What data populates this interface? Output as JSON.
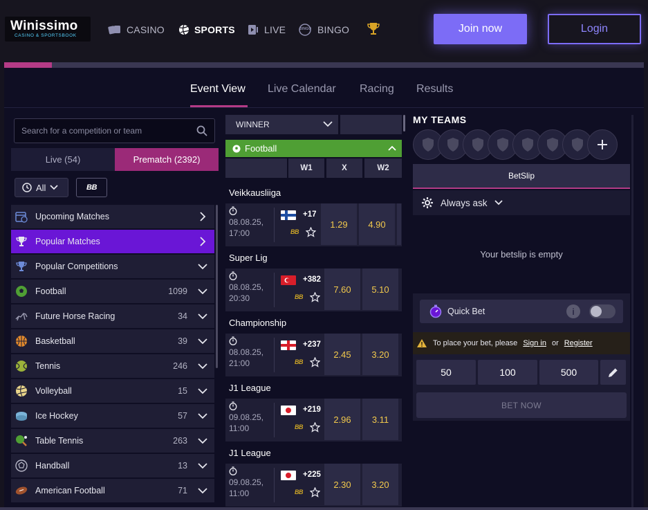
{
  "header": {
    "logo_text": "Winissimo",
    "logo_sub": "CASINO & SPORTSBOOK",
    "nav": [
      {
        "label": "CASINO"
      },
      {
        "label": "SPORTS"
      },
      {
        "label": "LIVE"
      },
      {
        "label": "BINGO"
      }
    ],
    "bingo_icon_text": "BINGO",
    "join_label": "Join now",
    "login_label": "Login"
  },
  "tabs": [
    "Event View",
    "Live Calendar",
    "Racing",
    "Results"
  ],
  "left": {
    "search_placeholder": "Search for a competition or team",
    "live_tab": "Live (54)",
    "prematch_tab": "Prematch (2392)",
    "time_filter": "All",
    "bb_label": "BB",
    "items": [
      {
        "label": "Upcoming Matches",
        "count": ""
      },
      {
        "label": "Popular Matches",
        "count": ""
      },
      {
        "label": "Popular Competitions",
        "count": ""
      },
      {
        "label": "Football",
        "count": "1099"
      },
      {
        "label": "Future Horse Racing",
        "count": "34"
      },
      {
        "label": "Basketball",
        "count": "39"
      },
      {
        "label": "Tennis",
        "count": "246"
      },
      {
        "label": "Volleyball",
        "count": "15"
      },
      {
        "label": "Ice Hockey",
        "count": "57"
      },
      {
        "label": "Table Tennis",
        "count": "263"
      },
      {
        "label": "Handball",
        "count": "13"
      },
      {
        "label": "American Football",
        "count": "71"
      }
    ]
  },
  "middle": {
    "market_select": "WINNER",
    "sport_bar": "Football",
    "odds_headers": [
      "W1",
      "X",
      "W2"
    ],
    "matches": [
      {
        "league": "Veikkausliiga",
        "date": "08.08.25,",
        "time": "17:00",
        "more": "+17",
        "bb": "BB",
        "odds": [
          "1.29",
          "4.90"
        ]
      },
      {
        "league": "Super Lig",
        "date": "08.08.25,",
        "time": "20:30",
        "more": "+382",
        "bb": "BB",
        "odds": [
          "7.60",
          "5.10"
        ]
      },
      {
        "league": "Championship",
        "date": "08.08.25,",
        "time": "21:00",
        "more": "+237",
        "bb": "BB",
        "odds": [
          "2.45",
          "3.20"
        ]
      },
      {
        "league": "J1 League",
        "date": "09.08.25,",
        "time": "11:00",
        "more": "+219",
        "bb": "BB",
        "odds": [
          "2.96",
          "3.11"
        ]
      },
      {
        "league": "J1 League",
        "date": "09.08.25,",
        "time": "11:00",
        "more": "+225",
        "bb": "BB",
        "odds": [
          "2.30",
          "3.20"
        ]
      }
    ]
  },
  "right": {
    "my_teams_title": "MY TEAMS",
    "betslip_tab": "BetSlip",
    "always_ask": "Always ask",
    "empty_text": "Your betslip is empty",
    "quick_bet": "Quick Bet",
    "info_glyph": "i",
    "warning_text": "To place your bet, please",
    "sign_in": "Sign in",
    "or_text": "or",
    "register": "Register",
    "stakes": [
      "50",
      "100",
      "500"
    ],
    "bet_now": "BET NOW"
  },
  "colors": {
    "accent_purple": "#7c6cf6",
    "accent_magenta": "#b43b86",
    "football_green": "#4f9f34",
    "odds_yellow": "#f2c94c",
    "highlight_purple": "#6a16d6"
  }
}
